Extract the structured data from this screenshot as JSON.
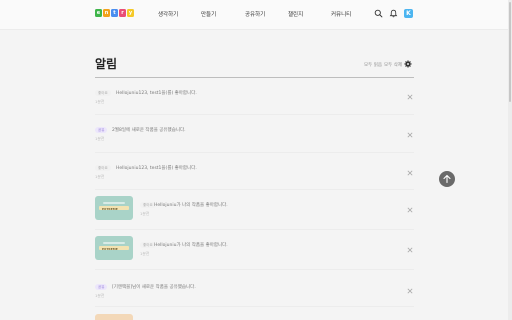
{
  "header": {
    "nav": [
      "생각하기",
      "만들기",
      "공유하기",
      "챌린지",
      "커뮤니티"
    ],
    "avatar_letter": "K"
  },
  "logo": {
    "letters": [
      "e",
      "n",
      "t",
      "r",
      "y"
    ],
    "colors": [
      "#3fb54a",
      "#f2a21b",
      "#4a8ef0",
      "#e94e77",
      "#f5c928"
    ]
  },
  "main": {
    "title": "알림",
    "mark_all_read": "모두 읽음",
    "delete_all": "모두 삭제"
  },
  "notifications": [
    {
      "badge": "좋아요",
      "badge_color": "gray",
      "message": "Hellojuniu123, test1을(를) 좋아합니다.",
      "time": "1분전",
      "thumb": false
    },
    {
      "badge": "공유",
      "badge_color": "purple",
      "message": "2월8일에 새로운 작품을 공유했습니다.",
      "time": "1분전",
      "thumb": false
    },
    {
      "badge": "좋아요",
      "badge_color": "gray",
      "message": "Hellojuniu123, test1을(를) 좋아합니다.",
      "time": "1분전",
      "thumb": false
    },
    {
      "badge": "좋아요",
      "badge_color": "gray",
      "message": "Hellojuniu가 나의 작품을 좋아합니다.",
      "time": "1분전",
      "thumb": true,
      "thumb_label": "EXTREME"
    },
    {
      "badge": "좋아요",
      "badge_color": "gray",
      "message": "Hellojuniu가 나의 작품을 좋아합니다.",
      "time": "1분전",
      "thumb": true,
      "thumb_label": "EXTREME"
    },
    {
      "badge": "공유",
      "badge_color": "purple",
      "message": "[기엔땍블]님이 새로운 작품을 공유했습니다.",
      "time": "1분전",
      "thumb": false
    }
  ]
}
